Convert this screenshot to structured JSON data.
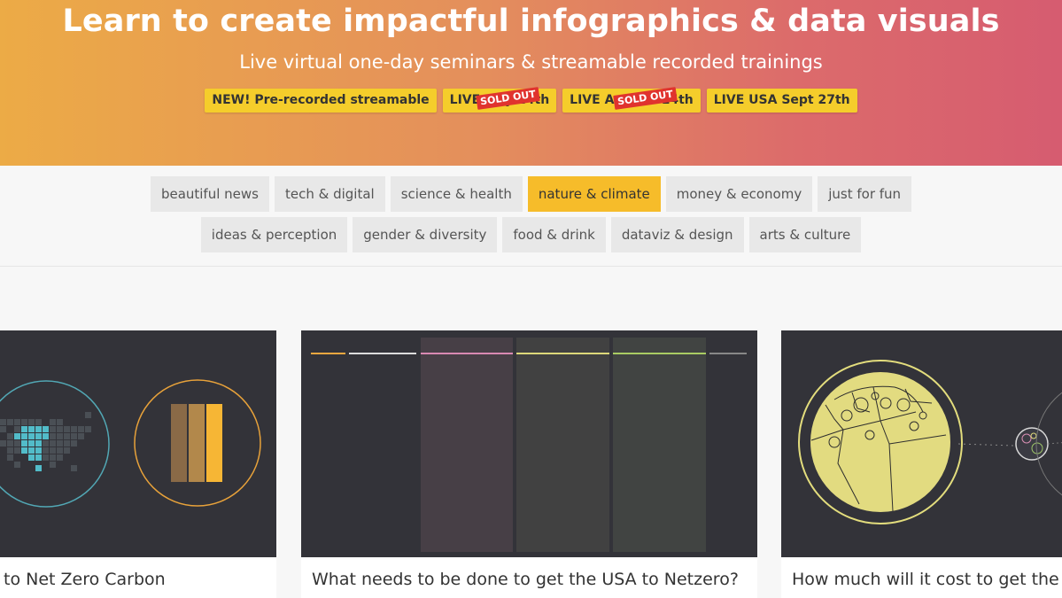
{
  "hero": {
    "title": "Learn to create impactful infographics & data visuals",
    "subtitle": "Live virtual one-day seminars & streamable recorded trainings",
    "badges": [
      {
        "label": "NEW! Pre-recorded streamable"
      },
      {
        "label": "LIVE May 24th",
        "stamp": "SOLD OUT"
      },
      {
        "label": "LIVE Aus Jun 14th",
        "stamp": "SOLD OUT"
      },
      {
        "label": "LIVE USA Sept 27th"
      }
    ],
    "colors": {
      "gradient_start": "#ecab46",
      "gradient_end": "#d65c70",
      "badge": "#f5cd2b",
      "stamp": "#e0332e"
    }
  },
  "categories": {
    "row1": [
      "beautiful news",
      "tech & digital",
      "science & health",
      "nature & climate",
      "money & economy",
      "just for fun"
    ],
    "row2": [
      "ideas & perception",
      "gender & diversity",
      "food & drink",
      "dataviz & design",
      "arts & culture"
    ],
    "active": "nature & climate",
    "active_color": "#f6bc2a"
  },
  "cards": [
    {
      "title": "to Net Zero Carbon",
      "image_icon": "usa-map-and-bars-graphic"
    },
    {
      "title": "What needs to be done to get the USA to Netzero?",
      "image_icon": "timeline-columns-graphic"
    },
    {
      "title": "How much will it cost to get the USA",
      "image_icon": "voronoi-circle-graphic"
    }
  ]
}
